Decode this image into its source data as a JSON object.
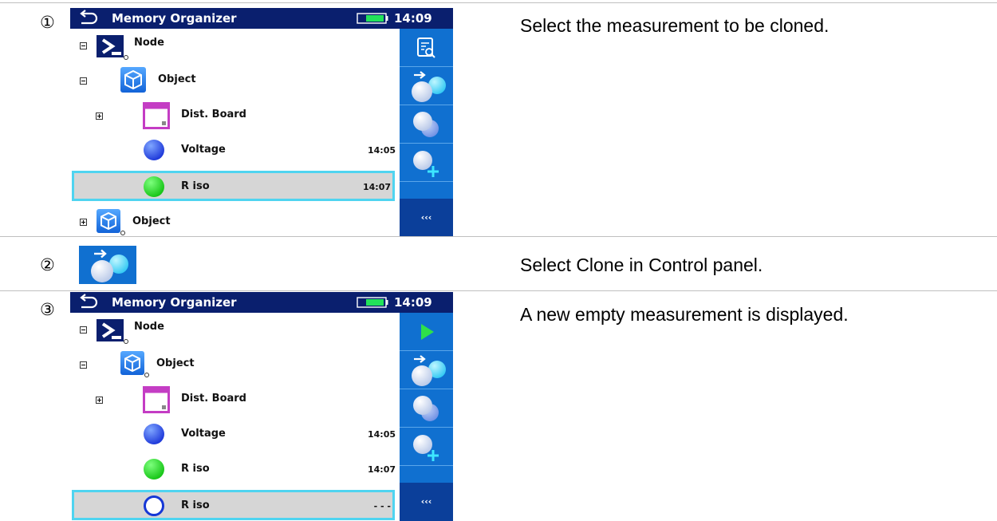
{
  "steps": [
    {
      "number": "①",
      "description": "Select the measurement to be cloned."
    },
    {
      "number": "②",
      "description": "Select Clone in Control panel."
    },
    {
      "number": "③",
      "description": "A new empty measurement is displayed."
    }
  ],
  "screen1": {
    "title": "Memory Organizer",
    "time": "14:09",
    "tree": [
      {
        "label": "Node",
        "icon": "node-icon",
        "expander": "minus",
        "time": ""
      },
      {
        "label": "Object",
        "icon": "object-icon",
        "expander": "minus",
        "time": ""
      },
      {
        "label": "Dist. Board",
        "icon": "dist-board-icon",
        "expander": "plus",
        "time": ""
      },
      {
        "label": "Voltage",
        "icon": "blue-measurement-icon",
        "time": "14:05"
      },
      {
        "label": "R iso",
        "icon": "green-measurement-icon",
        "time": "14:07",
        "selected": true
      },
      {
        "label": "Object",
        "icon": "object-icon",
        "expander": "plus",
        "time": ""
      }
    ],
    "panel": [
      "view-details-icon",
      "clone-icon",
      "clone-structure-icon",
      "add-measurement-icon"
    ],
    "more_label": "‹‹‹"
  },
  "screen3": {
    "title": "Memory Organizer",
    "time": "14:09",
    "tree": [
      {
        "label": "Node",
        "icon": "node-icon",
        "expander": "minus",
        "time": ""
      },
      {
        "label": "Object",
        "icon": "object-icon",
        "expander": "minus",
        "time": ""
      },
      {
        "label": "Dist. Board",
        "icon": "dist-board-icon",
        "expander": "plus",
        "time": ""
      },
      {
        "label": "Voltage",
        "icon": "blue-measurement-icon",
        "time": "14:05"
      },
      {
        "label": "R iso",
        "icon": "green-measurement-icon",
        "time": "14:07"
      },
      {
        "label": "R iso",
        "icon": "empty-measurement-icon",
        "time": "- - -",
        "selected": true
      }
    ],
    "panel": [
      "start-icon",
      "clone-icon",
      "clone-structure-icon",
      "add-measurement-icon"
    ],
    "more_label": "‹‹‹"
  },
  "colors": {
    "title_bar": "#0a1f6e",
    "control_panel": "#1070d0",
    "selection_border": "#4fd4f0",
    "selection_fill": "#d6d6d6"
  }
}
